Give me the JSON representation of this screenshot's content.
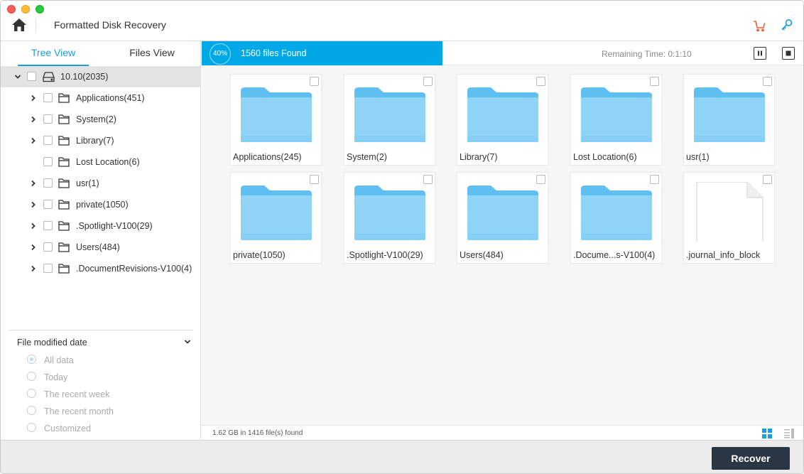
{
  "app": {
    "title": "Formatted Disk Recovery"
  },
  "colors": {
    "accent": "#00a9e6",
    "tab_active": "#1a9ee0",
    "cart": "#f05a3a",
    "key": "#1a9ee0",
    "recover_bg": "#2b3645",
    "folder": "#5fbff0"
  },
  "tabs": {
    "tree_view": "Tree View",
    "files_view": "Files View"
  },
  "tree": {
    "root": {
      "label": "10.10(2035)",
      "icon": "hard-drive-icon"
    },
    "items": [
      {
        "label": "Applications(451)",
        "expandable": true
      },
      {
        "label": "System(2)",
        "expandable": true
      },
      {
        "label": "Library(7)",
        "expandable": true
      },
      {
        "label": "Lost Location(6)",
        "expandable": false
      },
      {
        "label": "usr(1)",
        "expandable": true
      },
      {
        "label": "private(1050)",
        "expandable": true
      },
      {
        "label": ".Spotlight-V100(29)",
        "expandable": true
      },
      {
        "label": "Users(484)",
        "expandable": true
      },
      {
        "label": ".DocumentRevisions-V100(4)",
        "expandable": true
      }
    ]
  },
  "filter": {
    "title": "File modified date",
    "options": [
      "All data",
      "Today",
      "The recent week",
      "The recent month",
      "Customized"
    ],
    "selected": "All data"
  },
  "scan": {
    "percent": "40%",
    "progress": 0.4,
    "found": "1560 files Found",
    "remaining": "Remaining Time: 0:1:10"
  },
  "grid": {
    "items": [
      {
        "label": "Applications(245)",
        "type": "folder"
      },
      {
        "label": "System(2)",
        "type": "folder"
      },
      {
        "label": "Library(7)",
        "type": "folder"
      },
      {
        "label": "Lost Location(6)",
        "type": "folder"
      },
      {
        "label": "usr(1)",
        "type": "folder"
      },
      {
        "label": "private(1050)",
        "type": "folder"
      },
      {
        "label": ".Spotlight-V100(29)",
        "type": "folder"
      },
      {
        "label": "Users(484)",
        "type": "folder"
      },
      {
        "label": ".Docume...s-V100(4)",
        "type": "folder"
      },
      {
        "label": ".journal_info_block",
        "type": "file"
      }
    ]
  },
  "summary": "1.62 GB in 1416 file(s) found",
  "footer": {
    "recover_label": "Recover"
  }
}
